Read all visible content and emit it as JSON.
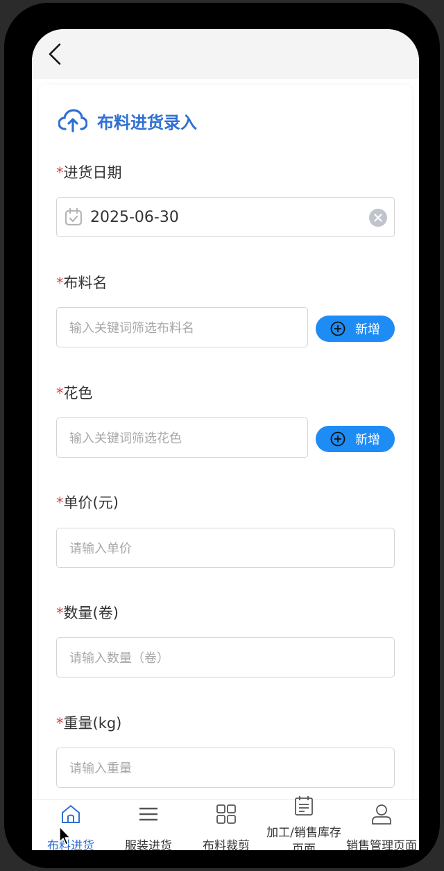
{
  "header": {
    "back_icon": "chevron-left-icon"
  },
  "form": {
    "title": "布料进货录入",
    "title_icon": "cloud-upload-icon",
    "required_mark": "*",
    "date": {
      "label": "进货日期",
      "value": "2025-06-30"
    },
    "fabric": {
      "label": "布料名",
      "placeholder": "输入关键词筛选布料名",
      "add_label": "新增"
    },
    "pattern": {
      "label": "花色",
      "placeholder": "输入关键词筛选花色",
      "add_label": "新增"
    },
    "price": {
      "label": "单价(元)",
      "placeholder": "请输入单价"
    },
    "quantity": {
      "label": "数量(卷)",
      "placeholder": "请输入数量（卷）"
    },
    "weight": {
      "label": "重量(kg)",
      "placeholder": "请输入重量"
    }
  },
  "tabbar": {
    "items": [
      {
        "label": "布料进货",
        "icon": "home-icon",
        "active": true
      },
      {
        "label": "服装进货",
        "icon": "menu-icon"
      },
      {
        "label": "布料裁剪",
        "icon": "grid-icon"
      },
      {
        "label": "加工/销售库存页面",
        "icon": "clipboard-icon"
      },
      {
        "label": "销售管理页面",
        "icon": "user-icon"
      }
    ]
  },
  "colors": {
    "accent": "#2f6fd3",
    "button": "#1e8cf5",
    "required": "#d0423c"
  }
}
